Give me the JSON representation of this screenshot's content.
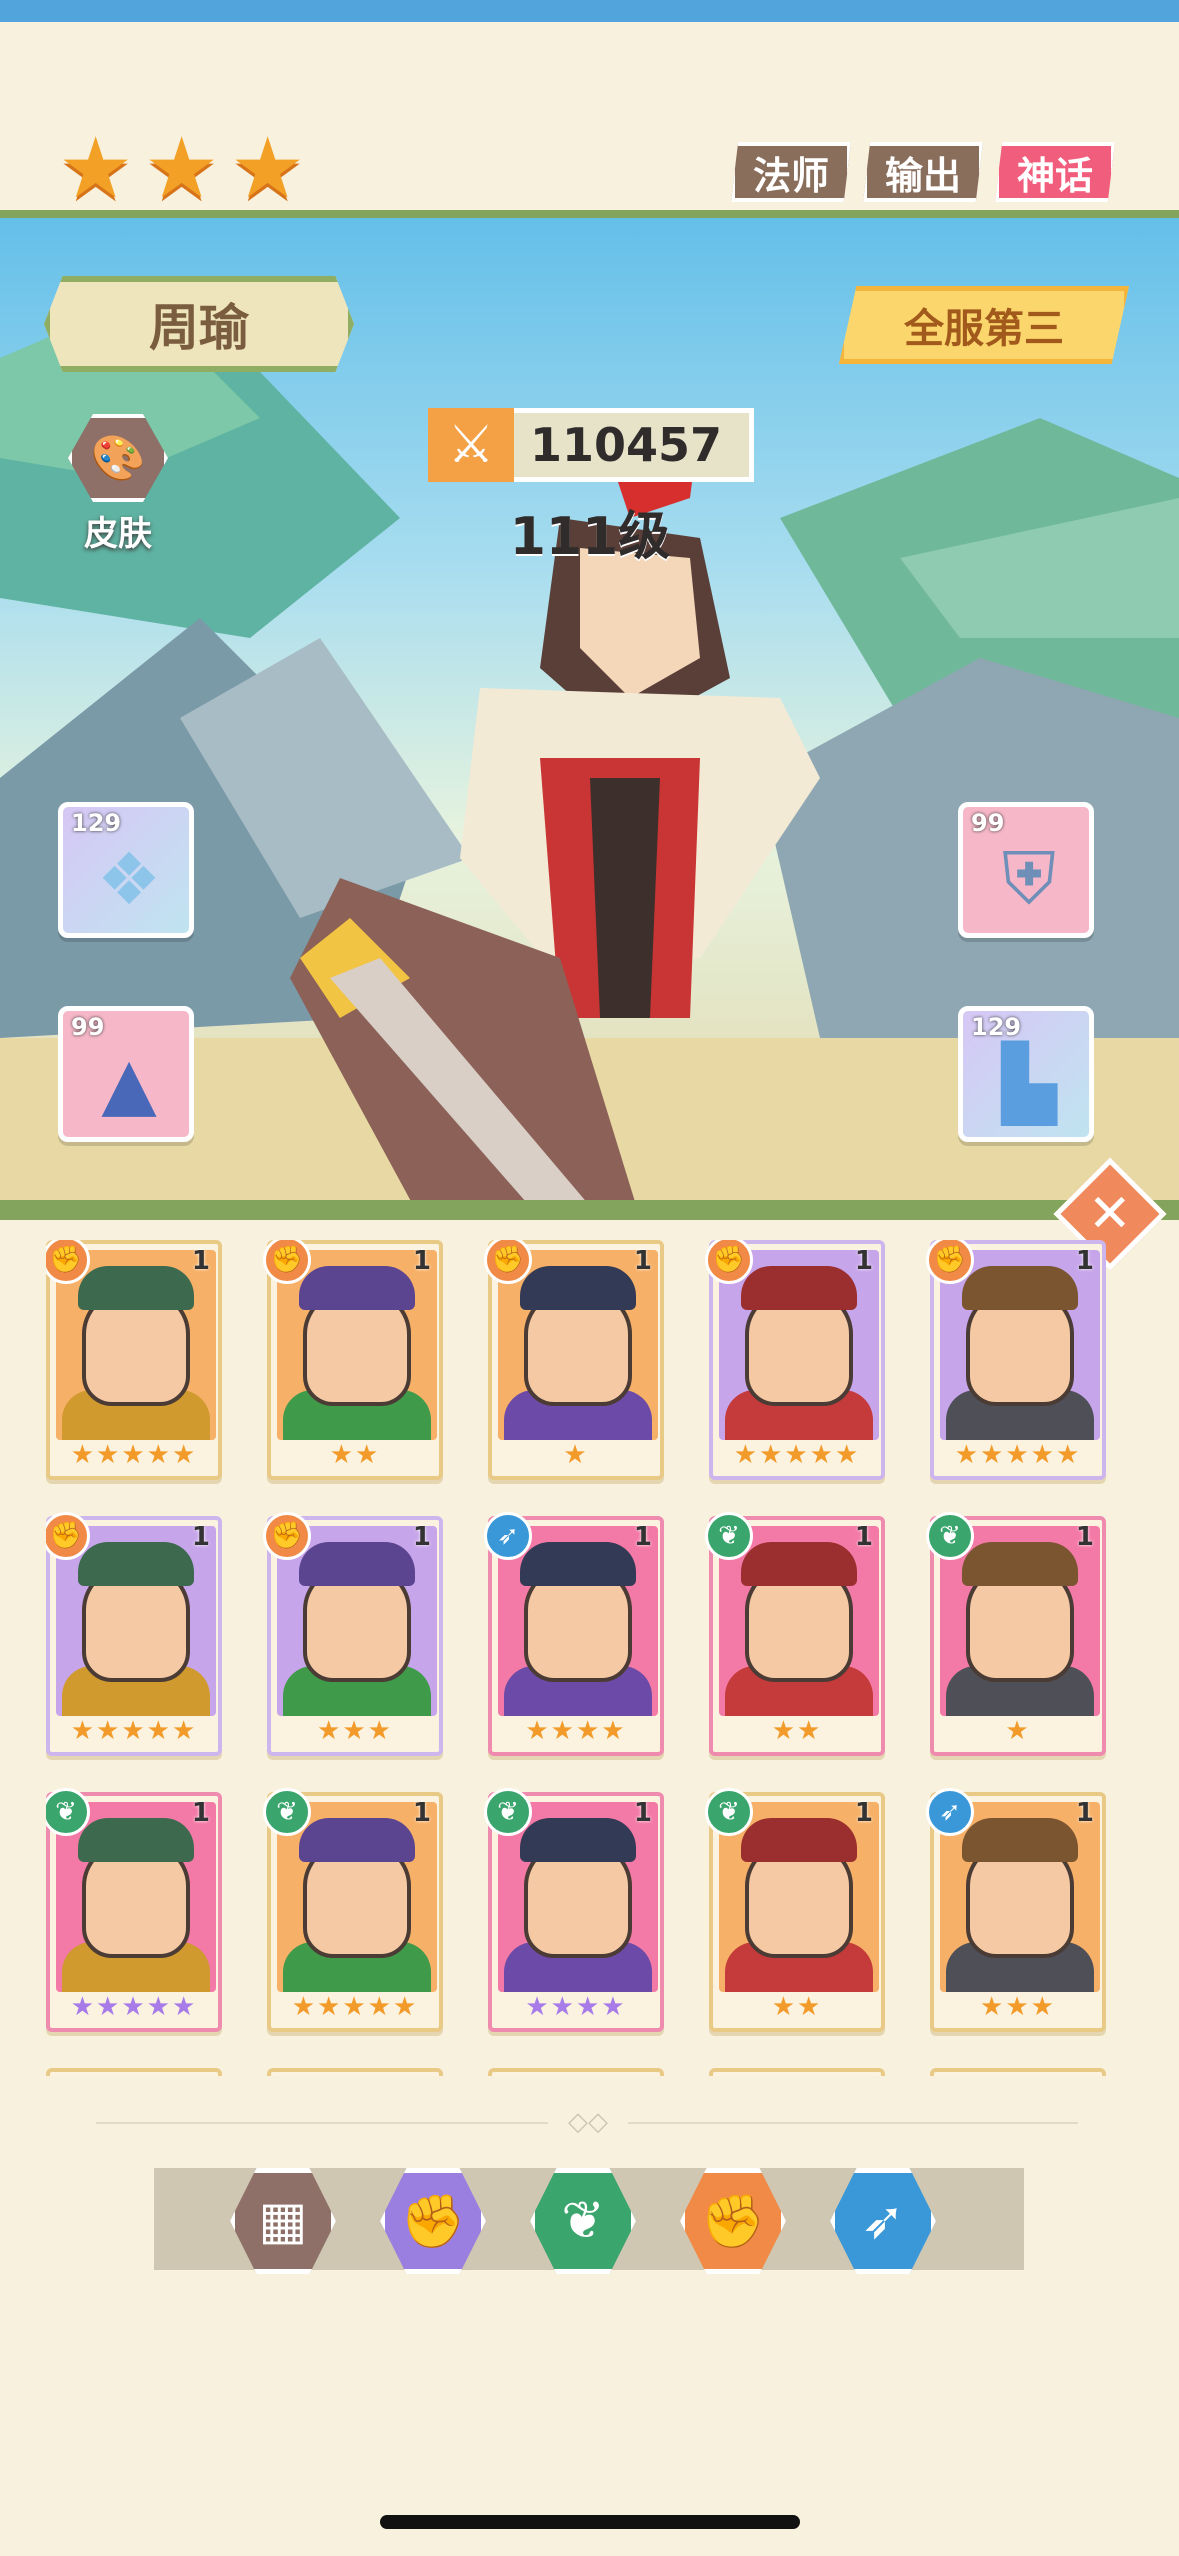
{
  "hero": {
    "name": "周瑜",
    "server_rank": "全服第三",
    "power": "110457",
    "level": "111级",
    "stars": 3,
    "skin_label": "皮肤"
  },
  "tags": [
    "法师",
    "输出",
    "神话"
  ],
  "equipment": [
    {
      "slot": "weapon",
      "level": "129",
      "icon": "crystal-fan-icon"
    },
    {
      "slot": "armor",
      "level": "99",
      "icon": "armor-icon"
    },
    {
      "slot": "helmet",
      "level": "99",
      "icon": "hat-icon"
    },
    {
      "slot": "boots",
      "level": "129",
      "icon": "boots-icon"
    }
  ],
  "roster": [
    {
      "element": "fire",
      "count": "1",
      "stars": "★★★★★",
      "star_color": "orange",
      "frame": "orange"
    },
    {
      "element": "fire",
      "count": "1",
      "stars": "★★",
      "star_color": "orange",
      "frame": "orange"
    },
    {
      "element": "fire",
      "count": "1",
      "stars": "★",
      "star_color": "orange",
      "frame": "orange"
    },
    {
      "element": "fire",
      "count": "1",
      "stars": "★★★★★",
      "star_color": "orange",
      "frame": "purple"
    },
    {
      "element": "fire",
      "count": "1",
      "stars": "★★★★★",
      "star_color": "orange",
      "frame": "purple"
    },
    {
      "element": "fire",
      "count": "1",
      "stars": "★★★★★",
      "star_color": "orange",
      "frame": "purple"
    },
    {
      "element": "fire",
      "count": "1",
      "stars": "★★★",
      "star_color": "orange",
      "frame": "purple"
    },
    {
      "element": "bow",
      "count": "1",
      "stars": "★★★★",
      "star_color": "orange",
      "frame": "pink"
    },
    {
      "element": "leaf",
      "count": "1",
      "stars": "★★",
      "star_color": "orange",
      "frame": "pink"
    },
    {
      "element": "leaf",
      "count": "1",
      "stars": "★",
      "star_color": "orange",
      "frame": "pink"
    },
    {
      "element": "leaf",
      "count": "1",
      "stars": "★★★★★",
      "star_color": "purple",
      "frame": "pink"
    },
    {
      "element": "leaf",
      "count": "1",
      "stars": "★★★★★",
      "star_color": "orange",
      "frame": "orange"
    },
    {
      "element": "leaf",
      "count": "1",
      "stars": "★★★★",
      "star_color": "purple",
      "frame": "pink"
    },
    {
      "element": "leaf",
      "count": "1",
      "stars": "★★",
      "star_color": "orange",
      "frame": "orange"
    },
    {
      "element": "bow",
      "count": "1",
      "stars": "★★★",
      "star_color": "orange",
      "frame": "orange"
    }
  ],
  "filter_tabs": [
    {
      "name": "all",
      "icon": "grid-icon",
      "color": "#8e7068",
      "active": true
    },
    {
      "name": "mage",
      "icon": "flame-icon",
      "color": "#9a7fe0",
      "active": false
    },
    {
      "name": "support",
      "icon": "leaf-icon",
      "color": "#3aa56d",
      "active": false
    },
    {
      "name": "warrior",
      "icon": "fist-icon",
      "color": "#f08a46",
      "active": false
    },
    {
      "name": "archer",
      "icon": "bow-icon",
      "color": "#3a98d8",
      "active": false
    }
  ],
  "colors": {
    "background": "#f8f1de",
    "accent_orange": "#f3a126",
    "myth_pink": "#f15e7d",
    "rail_green": "#83a45c"
  }
}
